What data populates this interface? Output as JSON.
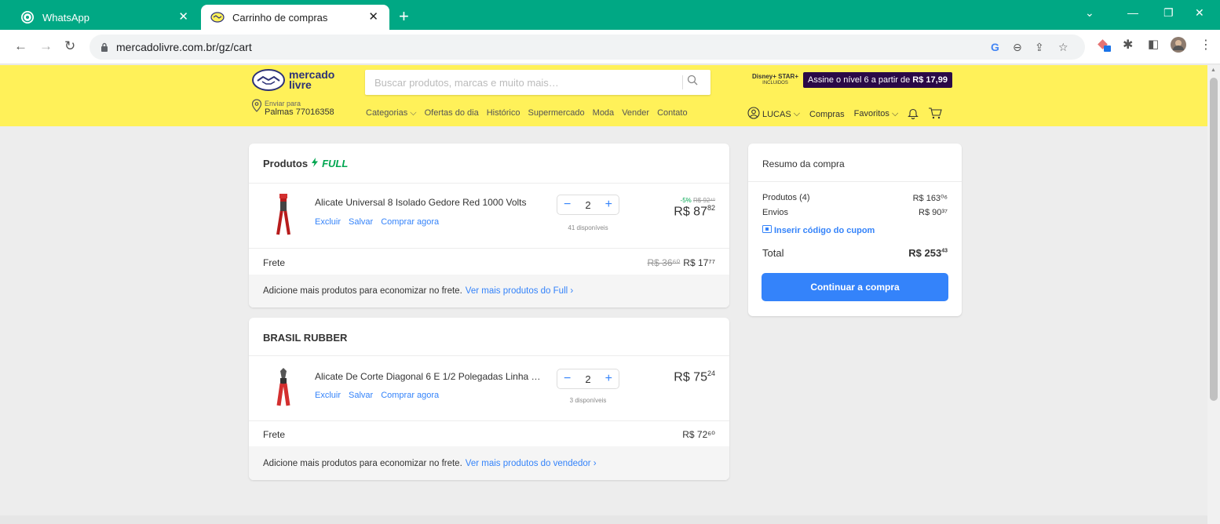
{
  "browser": {
    "tabs": [
      {
        "label": "WhatsApp",
        "active": false
      },
      {
        "label": "Carrinho de compras",
        "active": true
      }
    ],
    "url": "mercadolivre.com.br/gz/cart",
    "colors": {
      "tabbar": "#00a884",
      "accent_blue": "#3483fa",
      "header_yellow": "#fff159"
    }
  },
  "header": {
    "logo_line1": "mercado",
    "logo_line2": "livre",
    "search_placeholder": "Buscar produtos, marcas e muito mais…",
    "ship_label": "Enviar para",
    "ship_city": "Palmas 77016358",
    "categories": [
      "Categorias",
      "Ofertas do dia",
      "Histórico",
      "Supermercado",
      "Moda",
      "Vender",
      "Contato"
    ],
    "promo_brand": "Disney+ STAR+",
    "promo_sub": "INCLUIDOS",
    "promo_text": "Assine o nível 6 a partir de",
    "promo_price": "R$ 17,99",
    "user_name": "LUCAS",
    "compras": "Compras",
    "favoritos": "Favoritos"
  },
  "cart": {
    "full_group": {
      "title": "Produtos",
      "badge": "FULL",
      "item": {
        "title": "Alicate Universal 8 Isolado Gedore Red 1000 Volts",
        "actions": [
          "Excluir",
          "Salvar",
          "Comprar agora"
        ],
        "quantity": "2",
        "available": "41 disponíveis",
        "discount": "-5%",
        "old_price": "R$ 92⁴⁰",
        "price_main": "R$ 87",
        "price_cents": "82"
      },
      "frete_label": "Frete",
      "frete_old": "R$ 36⁶⁰",
      "frete_price": "R$ 17⁷⁷",
      "footer_text": "Adicione mais produtos para economizar no frete.",
      "footer_link": "Ver mais produtos do Full ›"
    },
    "seller_group": {
      "title": "BRASIL RUBBER",
      "item": {
        "title": "Alicate De Corte Diagonal 6 E 1/2 Polegadas Linha G...",
        "actions": [
          "Excluir",
          "Salvar",
          "Comprar agora"
        ],
        "quantity": "2",
        "available": "3 disponíveis",
        "price_main": "R$ 75",
        "price_cents": "24"
      },
      "frete_label": "Frete",
      "frete_price": "R$ 72⁶⁰",
      "footer_text": "Adicione mais produtos para economizar no frete.",
      "footer_link": "Ver mais produtos do vendedor ›"
    }
  },
  "summary": {
    "title": "Resumo da compra",
    "products_label": "Produtos (4)",
    "products_value": "R$ 163⁰⁶",
    "shipping_label": "Envios",
    "shipping_value": "R$ 90³⁷",
    "coupon": "Inserir código do cupom",
    "total_label": "Total",
    "total_value": "R$ 253",
    "total_cents": "43",
    "continue_label": "Continuar a compra"
  }
}
